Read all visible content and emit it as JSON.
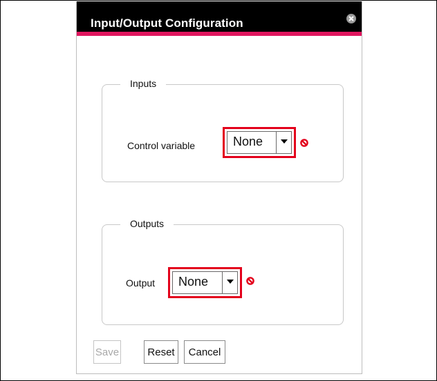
{
  "dialog": {
    "title": "Input/Output Configuration",
    "close_icon": "close-circle-icon"
  },
  "inputs": {
    "legend": "Inputs",
    "control_variable_label": "Control variable",
    "control_variable_value": "None",
    "status_icon": "no-entry-icon"
  },
  "outputs": {
    "legend": "Outputs",
    "output_label": "Output",
    "output_value": "None",
    "status_icon": "no-entry-icon"
  },
  "buttons": {
    "save": "Save",
    "reset": "Reset",
    "cancel": "Cancel",
    "save_enabled": false
  },
  "colors": {
    "titlebar": "#000000",
    "accent_stripe": "#e0165f",
    "highlight": "#e3001b",
    "status_icon": "#e3001b"
  }
}
